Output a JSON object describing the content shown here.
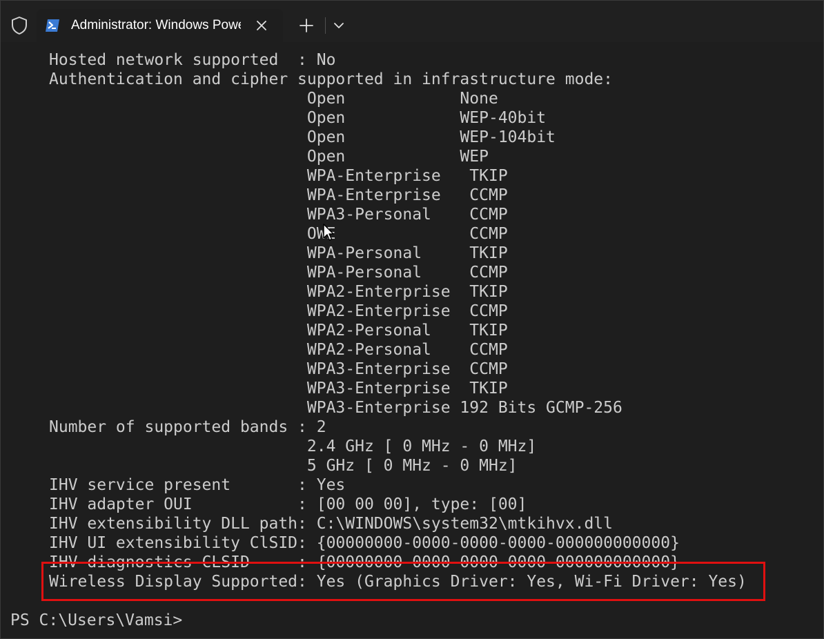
{
  "titlebar": {
    "tab_title": "Administrator: Windows Powe"
  },
  "terminal": {
    "lines": [
      "Hosted network supported  : No",
      "Authentication and cipher supported in infrastructure mode:",
      "                           Open            None",
      "                           Open            WEP-40bit",
      "                           Open            WEP-104bit",
      "                           Open            WEP",
      "                           WPA-Enterprise   TKIP",
      "                           WPA-Enterprise   CCMP",
      "                           WPA3-Personal    CCMP",
      "                           OWE              CCMP",
      "                           WPA-Personal     TKIP",
      "                           WPA-Personal     CCMP",
      "                           WPA2-Enterprise  TKIP",
      "                           WPA2-Enterprise  CCMP",
      "                           WPA2-Personal    TKIP",
      "                           WPA2-Personal    CCMP",
      "                           WPA3-Enterprise  CCMP",
      "                           WPA3-Enterprise  TKIP",
      "                           WPA3-Enterprise 192 Bits GCMP-256",
      "Number of supported bands : 2",
      "                           2.4 GHz [ 0 MHz - 0 MHz]",
      "                           5 GHz [ 0 MHz - 0 MHz]",
      "IHV service present       : Yes",
      "IHV adapter OUI           : [00 00 00], type: [00]",
      "IHV extensibility DLL path: C:\\WINDOWS\\system32\\mtkihvx.dll",
      "IHV UI extensibility ClSID: {00000000-0000-0000-0000-000000000000}",
      "IHV diagnostics CLSID     : {00000000-0000-0000-0000-000000000000}",
      "Wireless Display Supported: Yes (Graphics Driver: Yes, Wi-Fi Driver: Yes)"
    ],
    "prompt": "PS C:\\Users\\Vamsi>"
  },
  "colors": {
    "background": "#1e1e1e",
    "text": "#cccccc",
    "highlight": "#e01010"
  },
  "icons": {
    "shield": "shield-icon",
    "powershell": "powershell-icon",
    "close": "close-icon",
    "new_tab": "plus-icon",
    "dropdown": "chevron-down-icon",
    "cursor": "mouse-cursor-icon"
  }
}
